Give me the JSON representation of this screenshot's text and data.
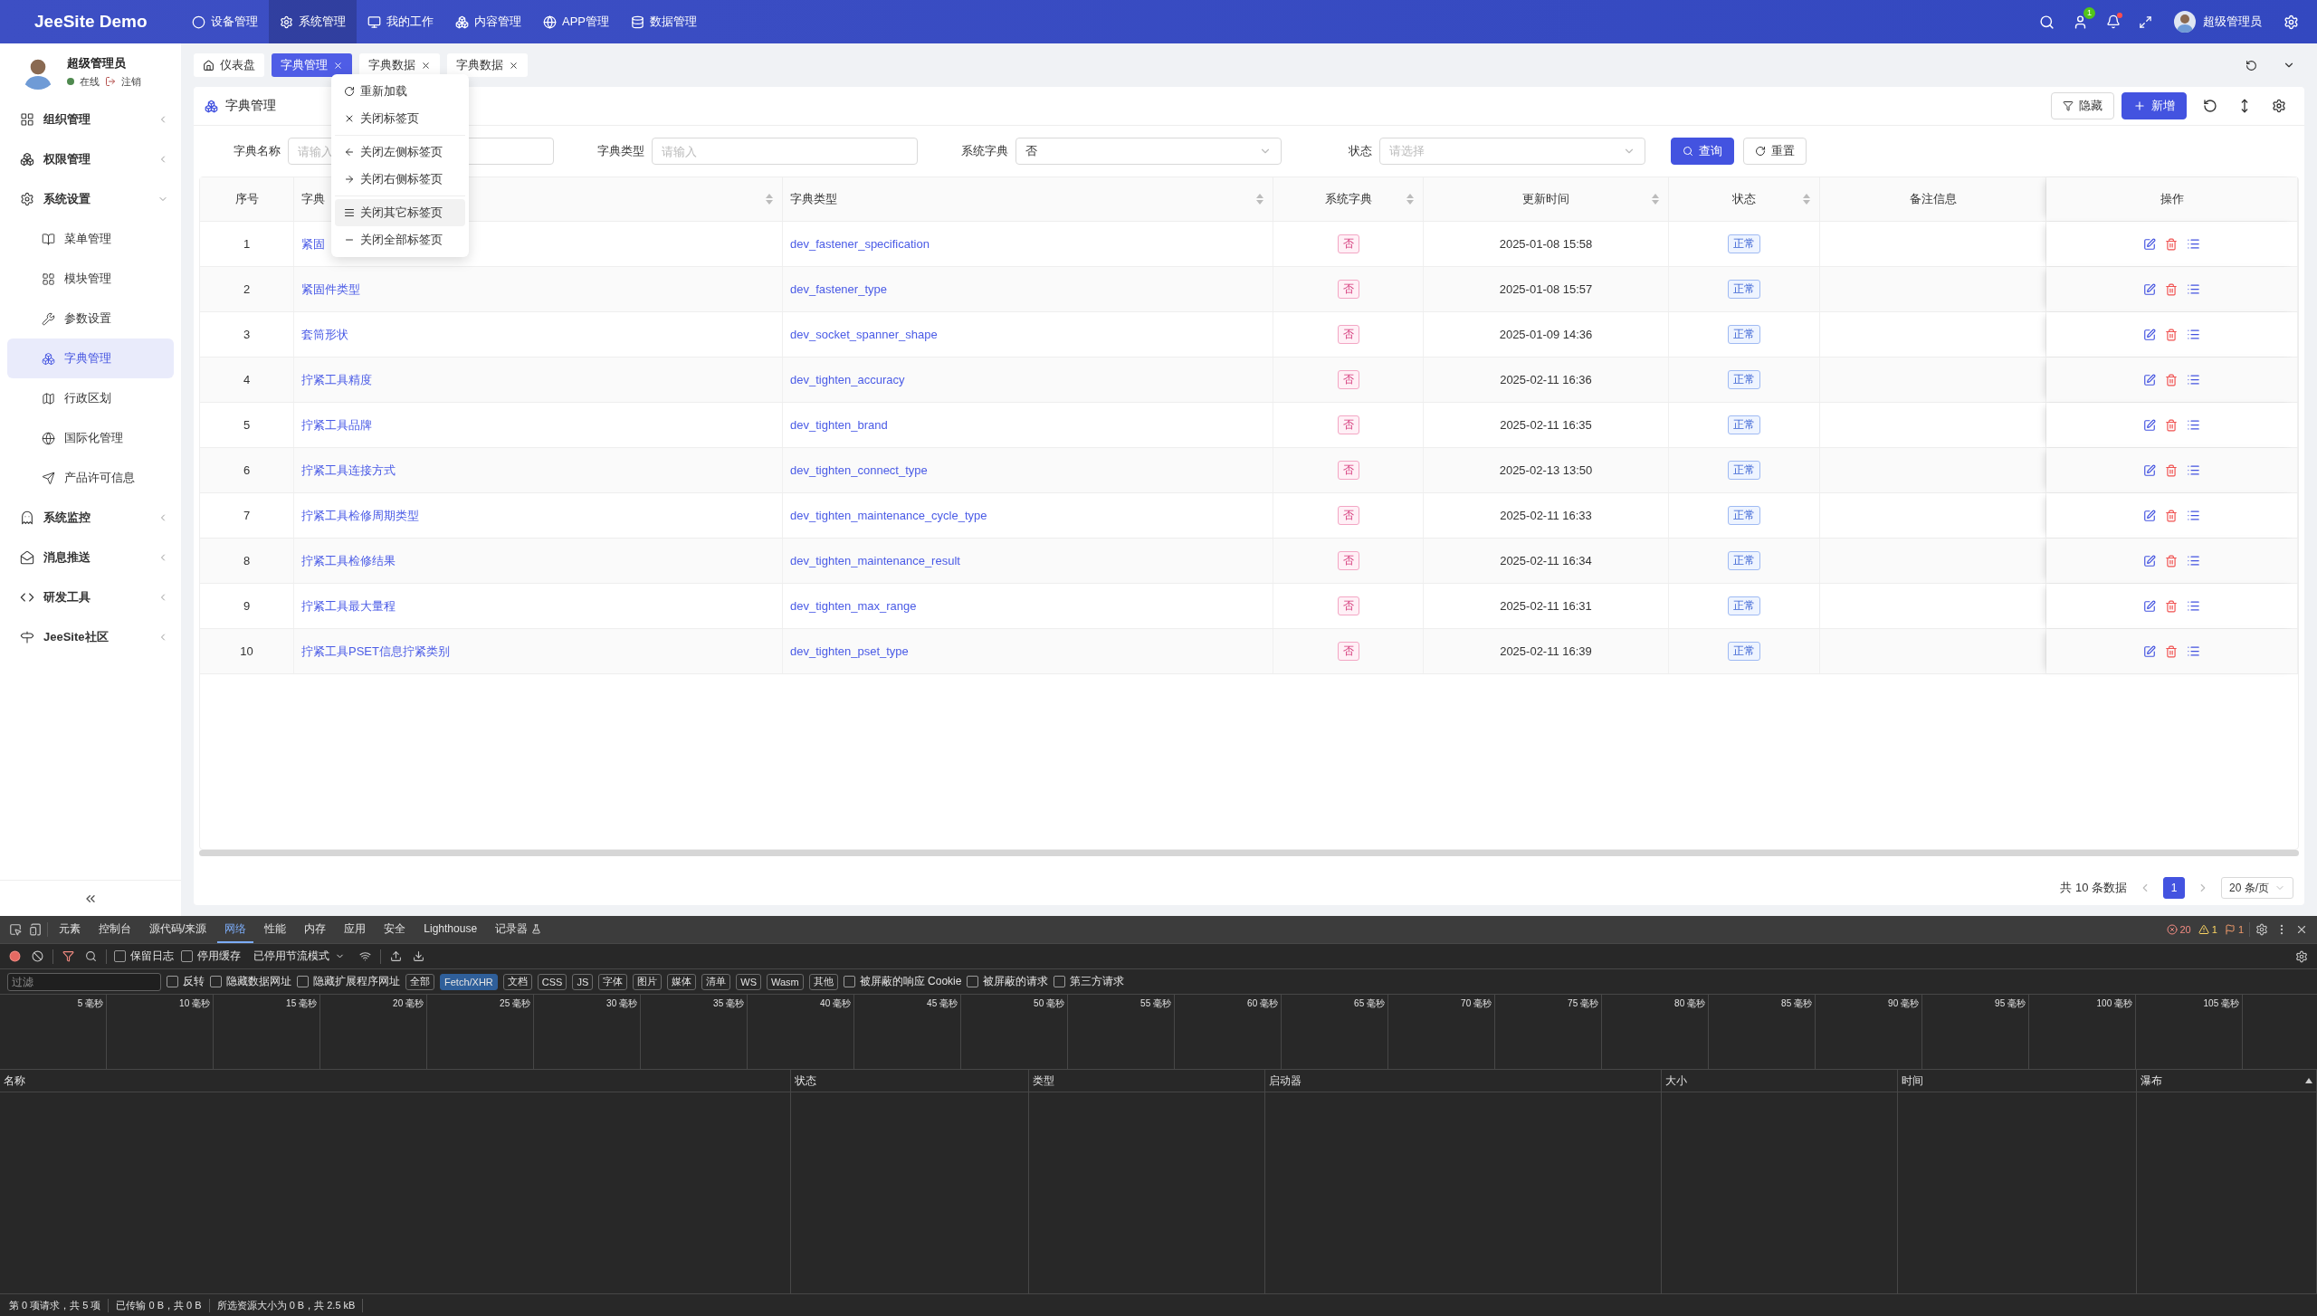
{
  "top_nav": {
    "brand": "JeeSite Demo",
    "menus": [
      {
        "label": "设备管理",
        "selected": false
      },
      {
        "label": "系统管理",
        "selected": true
      },
      {
        "label": "我的工作",
        "selected": false
      },
      {
        "label": "内容管理",
        "selected": false
      },
      {
        "label": "APP管理",
        "selected": false
      },
      {
        "label": "数据管理",
        "selected": false
      }
    ],
    "message_badge": "1",
    "notification_dot": true,
    "user_name": "超级管理员"
  },
  "sidebar": {
    "user": {
      "name": "超级管理员",
      "status": "在线",
      "logout": "注销"
    },
    "items": [
      {
        "label": "组织管理",
        "expanded": false
      },
      {
        "label": "权限管理",
        "expanded": false
      },
      {
        "label": "系统设置",
        "expanded": true,
        "children": [
          {
            "label": "菜单管理",
            "selected": false
          },
          {
            "label": "模块管理",
            "selected": false
          },
          {
            "label": "参数设置",
            "selected": false
          },
          {
            "label": "字典管理",
            "selected": true
          },
          {
            "label": "行政区划",
            "selected": false
          },
          {
            "label": "国际化管理",
            "selected": false
          },
          {
            "label": "产品许可信息",
            "selected": false
          }
        ]
      },
      {
        "label": "系统监控",
        "expanded": false
      },
      {
        "label": "消息推送",
        "expanded": false
      },
      {
        "label": "研发工具",
        "expanded": false
      },
      {
        "label": "JeeSite社区",
        "expanded": false
      }
    ]
  },
  "tabs": [
    {
      "label": "仪表盘",
      "selected": false,
      "closable": false
    },
    {
      "label": "字典管理",
      "selected": true,
      "closable": true
    },
    {
      "label": "字典数据",
      "selected": false,
      "closable": true
    },
    {
      "label": "字典数据",
      "selected": false,
      "closable": true
    }
  ],
  "context_menu": {
    "groups": [
      [
        {
          "label": "重新加载",
          "hovered": false
        },
        {
          "label": "关闭标签页",
          "hovered": false
        }
      ],
      [
        {
          "label": "关闭左侧标签页",
          "hovered": false
        },
        {
          "label": "关闭右侧标签页",
          "hovered": false
        }
      ],
      [
        {
          "label": "关闭其它标签页",
          "hovered": true
        },
        {
          "label": "关闭全部标签页",
          "hovered": false
        }
      ]
    ]
  },
  "page": {
    "title": "字典管理",
    "actions": [
      {
        "label": "隐藏",
        "kind": "filter"
      },
      {
        "label": "新增",
        "kind": "primary"
      }
    ]
  },
  "filters": [
    {
      "label": "字典名称",
      "kind": "input",
      "placeholder": "请输入"
    },
    {
      "label": "字典类型",
      "kind": "input",
      "placeholder": "请输入"
    },
    {
      "label": "系统字典",
      "kind": "select",
      "value": "否"
    },
    {
      "label": "状态",
      "kind": "select",
      "placeholder": "请选择"
    }
  ],
  "filter_buttons": [
    {
      "label": "查询",
      "kind": "primary"
    },
    {
      "label": "重置",
      "kind": "default"
    }
  ],
  "table": {
    "columns": [
      {
        "label": "序号",
        "sortable": false
      },
      {
        "label": "字典",
        "sortable": true
      },
      {
        "label": "字典类型",
        "sortable": true
      },
      {
        "label": "系统字典",
        "sortable": true
      },
      {
        "label": "更新时间",
        "sortable": true
      },
      {
        "label": "状态",
        "sortable": true
      },
      {
        "label": "备注信息",
        "sortable": false
      },
      {
        "label": "操作",
        "sortable": false
      }
    ],
    "rows": [
      {
        "index": "1",
        "name": "紧固",
        "type": "dev_fastener_specification",
        "system": "否",
        "updated": "2025-01-08 15:58",
        "status": "正常"
      },
      {
        "index": "2",
        "name": "紧固件类型",
        "type": "dev_fastener_type",
        "system": "否",
        "updated": "2025-01-08 15:57",
        "status": "正常"
      },
      {
        "index": "3",
        "name": "套筒形状",
        "type": "dev_socket_spanner_shape",
        "system": "否",
        "updated": "2025-01-09 14:36",
        "status": "正常"
      },
      {
        "index": "4",
        "name": "拧紧工具精度",
        "type": "dev_tighten_accuracy",
        "system": "否",
        "updated": "2025-02-11 16:36",
        "status": "正常"
      },
      {
        "index": "5",
        "name": "拧紧工具品牌",
        "type": "dev_tighten_brand",
        "system": "否",
        "updated": "2025-02-11 16:35",
        "status": "正常"
      },
      {
        "index": "6",
        "name": "拧紧工具连接方式",
        "type": "dev_tighten_connect_type",
        "system": "否",
        "updated": "2025-02-13 13:50",
        "status": "正常"
      },
      {
        "index": "7",
        "name": "拧紧工具检修周期类型",
        "type": "dev_tighten_maintenance_cycle_type",
        "system": "否",
        "updated": "2025-02-11 16:33",
        "status": "正常"
      },
      {
        "index": "8",
        "name": "拧紧工具检修结果",
        "type": "dev_tighten_maintenance_result",
        "system": "否",
        "updated": "2025-02-11 16:34",
        "status": "正常"
      },
      {
        "index": "9",
        "name": "拧紧工具最大量程",
        "type": "dev_tighten_max_range",
        "system": "否",
        "updated": "2025-02-11 16:31",
        "status": "正常"
      },
      {
        "index": "10",
        "name": "拧紧工具PSET信息拧紧类别",
        "type": "dev_tighten_pset_type",
        "system": "否",
        "updated": "2025-02-11 16:39",
        "status": "正常"
      }
    ]
  },
  "pagination": {
    "total": "共 10 条数据",
    "pages": [
      {
        "label": "1",
        "selected": true
      }
    ],
    "page_size": "20 条/页"
  },
  "devtools": {
    "tabs": [
      {
        "label": "元素",
        "selected": false
      },
      {
        "label": "控制台",
        "selected": false
      },
      {
        "label": "源代码/来源",
        "selected": false
      },
      {
        "label": "网络",
        "selected": true
      },
      {
        "label": "性能",
        "selected": false
      },
      {
        "label": "内存",
        "selected": false
      },
      {
        "label": "应用",
        "selected": false
      },
      {
        "label": "安全",
        "selected": false
      },
      {
        "label": "Lighthouse",
        "selected": false
      },
      {
        "label": "记录器",
        "selected": false
      }
    ],
    "errors": "20",
    "warnings": "1",
    "issues": "1",
    "toolbar_checkboxes": [
      {
        "label": "保留日志",
        "checked": false
      },
      {
        "label": "停用缓存",
        "checked": false
      }
    ],
    "throttle": "已停用节流模式",
    "filter_placeholder": "过滤",
    "filter_checkboxes": [
      {
        "label": "反转",
        "checked": false
      },
      {
        "label": "隐藏数据网址",
        "checked": false
      },
      {
        "label": "隐藏扩展程序网址",
        "checked": false
      }
    ],
    "types": [
      {
        "label": "全部",
        "selected": false
      },
      {
        "label": "Fetch/XHR",
        "selected": true
      },
      {
        "label": "文档",
        "selected": false
      },
      {
        "label": "CSS",
        "selected": false
      },
      {
        "label": "JS",
        "selected": false
      },
      {
        "label": "字体",
        "selected": false
      },
      {
        "label": "图片",
        "selected": false
      },
      {
        "label": "媒体",
        "selected": false
      },
      {
        "label": "清单",
        "selected": false
      },
      {
        "label": "WS",
        "selected": false
      },
      {
        "label": "Wasm",
        "selected": false
      },
      {
        "label": "其他",
        "selected": false
      }
    ],
    "extra_checkboxes": [
      {
        "label": "被屏蔽的响应 Cookie",
        "checked": false
      },
      {
        "label": "被屏蔽的请求",
        "checked": false
      },
      {
        "label": "第三方请求",
        "checked": false
      }
    ],
    "timeline_ticks": [
      "5 毫秒",
      "10 毫秒",
      "15 毫秒",
      "20 毫秒",
      "25 毫秒",
      "30 毫秒",
      "35 毫秒",
      "40 毫秒",
      "45 毫秒",
      "50 毫秒",
      "55 毫秒",
      "60 毫秒",
      "65 毫秒",
      "70 毫秒",
      "75 毫秒",
      "80 毫秒",
      "85 毫秒",
      "90 毫秒",
      "95 毫秒",
      "100 毫秒",
      "105 毫秒"
    ],
    "columns": [
      "名称",
      "状态",
      "类型",
      "启动器",
      "大小",
      "时间",
      "瀑布"
    ],
    "status": [
      "第 0 项请求，共 5 项",
      "已传输 0 B，共 0 B",
      "所选资源大小为 0 B，共 2.5 kB"
    ]
  }
}
